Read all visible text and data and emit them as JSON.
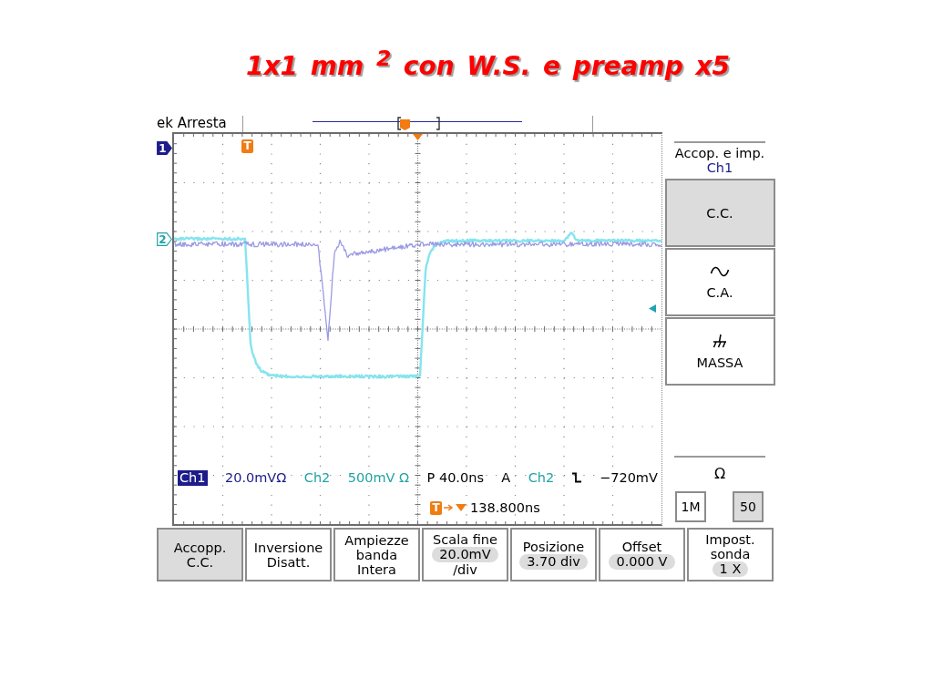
{
  "title": "1x1 mm $^{2}$ con W.S. e preamp x5",
  "scope": {
    "status": "ek Arresta",
    "channel_markers": [
      {
        "label": "1",
        "selected": true,
        "color": "#1c1c8a"
      },
      {
        "label": "2",
        "selected": false,
        "color": "#21a3a3"
      }
    ],
    "trigger_marker": "T",
    "readout": [
      {
        "kind": "badge",
        "text": "Ch1",
        "color": "#1c1c8a"
      },
      {
        "kind": "text",
        "text": "20.0mVΩ",
        "color": "#1c1c8a"
      },
      {
        "kind": "text",
        "text": "Ch2",
        "color": "#21a3a3"
      },
      {
        "kind": "text",
        "text": "500mV Ω",
        "color": "#21a3a3"
      },
      {
        "kind": "text",
        "text": "P 40.0ns",
        "color": "#000000"
      },
      {
        "kind": "text",
        "text": "A",
        "color": "#000000"
      },
      {
        "kind": "text",
        "text": "Ch2",
        "color": "#21a3a3"
      },
      {
        "kind": "falling-edge"
      },
      {
        "kind": "text",
        "text": "−720mV",
        "color": "#000000"
      }
    ],
    "trigger_delay": {
      "marker": "T",
      "value": "138.800ns"
    },
    "side_menu": {
      "title": "Accop. e imp.",
      "channel": "Ch1",
      "options": [
        {
          "kind": "dc",
          "label": "C.C.",
          "selected": true
        },
        {
          "kind": "ac",
          "label": "C.A.",
          "selected": false
        },
        {
          "kind": "ground",
          "label": "MASSA",
          "selected": false
        }
      ],
      "impedance_label": "Ω",
      "impedance_options": [
        {
          "label": "1M",
          "selected": false
        },
        {
          "label": "50",
          "selected": true
        }
      ]
    },
    "bottom_menu": [
      {
        "kind": "plain",
        "lines": [
          "Accopp.",
          "C.C."
        ],
        "selected": true
      },
      {
        "kind": "plain",
        "lines": [
          "Inversione",
          "Disatt."
        ],
        "selected": false
      },
      {
        "kind": "plain",
        "lines": [
          "Ampiezze",
          "banda",
          "Intera"
        ],
        "selected": false
      },
      {
        "kind": "pill",
        "lines": [
          "Scala fine"
        ],
        "value": "20.0mV",
        "suffix": "/div",
        "selected": false
      },
      {
        "kind": "pill",
        "lines": [
          "Posizione"
        ],
        "value": "3.70 div",
        "selected": false
      },
      {
        "kind": "pill",
        "lines": [
          "Offset"
        ],
        "value": "0.000 V",
        "selected": false
      },
      {
        "kind": "pill",
        "lines": [
          "Impost.",
          "sonda"
        ],
        "value": "1 X",
        "selected": false
      }
    ]
  }
}
